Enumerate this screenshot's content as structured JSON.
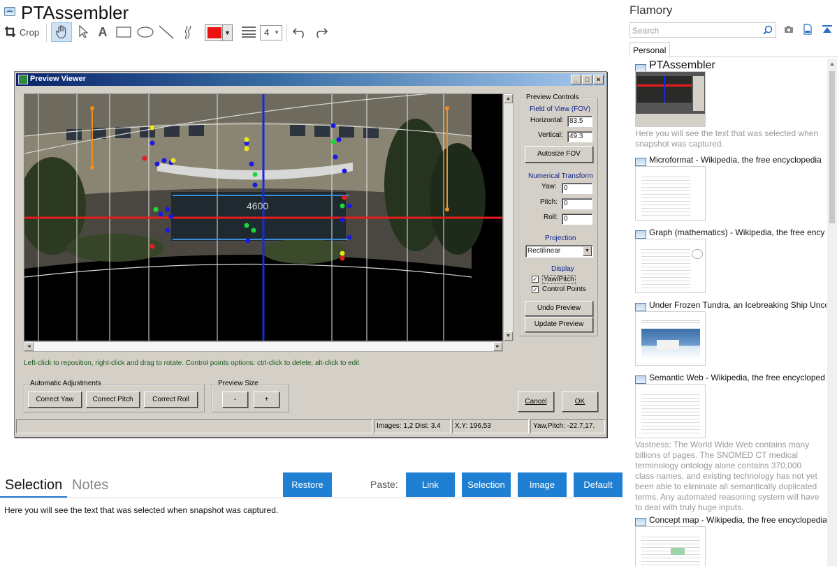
{
  "app": {
    "title": "PTAssembler"
  },
  "toolbar": {
    "crop_label": "Crop",
    "line_width_value": "4"
  },
  "preview_window": {
    "title": "Preview Viewer",
    "controls_title": "Preview Controls",
    "fov_title": "Field of View (FOV)",
    "horizontal_label": "Horizontal:",
    "horizontal_value": "83.5",
    "vertical_label": "Vertical:",
    "vertical_value": "49.3",
    "autosize_label": "Autosize FOV",
    "numerical_title": "Numerical Transform",
    "yaw_label": "Yaw:",
    "yaw_value": "0",
    "pitch_label": "Pitch:",
    "pitch_value": "0",
    "roll_label": "Roll:",
    "roll_value": "0",
    "projection_title": "Projection",
    "projection_value": "Rectilinear",
    "display_title": "Display",
    "yaw_pitch_label": "Yaw/Pitch",
    "control_points_label": "Control Points",
    "undo_preview": "Undo Preview",
    "update_preview": "Update Preview",
    "hint": "Left-click to reposition, right-click and drag to rotate. Control points options: ctrl-click to delete, alt-click to edit",
    "auto_title": "Automatic Adjustments",
    "correct_yaw": "Correct Yaw",
    "correct_pitch": "Correct Pitch",
    "correct_roll": "Correct Roll",
    "preview_size_title": "Preview Size",
    "minus": "-",
    "plus": "+",
    "cancel": "Cancel",
    "ok": "OK",
    "status_images": "Images: 1,2  Dist: 3.4",
    "status_xy": "X,Y: 196,53",
    "status_yawpitch": "Yaw,Pitch: -22.7,17."
  },
  "selection": {
    "tab_selection": "Selection",
    "tab_notes": "Notes",
    "restore": "Restore",
    "paste_label": "Paste:",
    "link": "Link",
    "selection_btn": "Selection",
    "image": "Image",
    "default": "Default",
    "text": "Here you will see the text that was selected when snapshot was captured."
  },
  "right_panel": {
    "title": "Flamory",
    "search_placeholder": "Search",
    "tab_personal": "Personal",
    "items": [
      {
        "title": "PTAssembler",
        "desc": "Here you will see the text that was selected when snapshot was captured."
      },
      {
        "title": "Microformat - Wikipedia, the free encyclopedia"
      },
      {
        "title": "Graph (mathematics) - Wikipedia, the free ency"
      },
      {
        "title": "Under Frozen Tundra, an Icebreaking Ship Unco"
      },
      {
        "title": "Semantic Web - Wikipedia, the free encycloped",
        "desc": "Vastness: The World Wide Web contains many billions of pages. The SNOMED CT medical terminology ontology alone contains 370,000 class names, and existing technology has not yet been able to eliminate all semantically duplicated terms. Any automated reasoning system will have to deal with truly huge inputs."
      },
      {
        "title": "Concept map - Wikipedia, the free encyclopedia"
      }
    ]
  },
  "colors": {
    "accent_blue": "#1e7fd3",
    "draw_color": "#ee1111",
    "win_face": "#d4d0c8"
  }
}
